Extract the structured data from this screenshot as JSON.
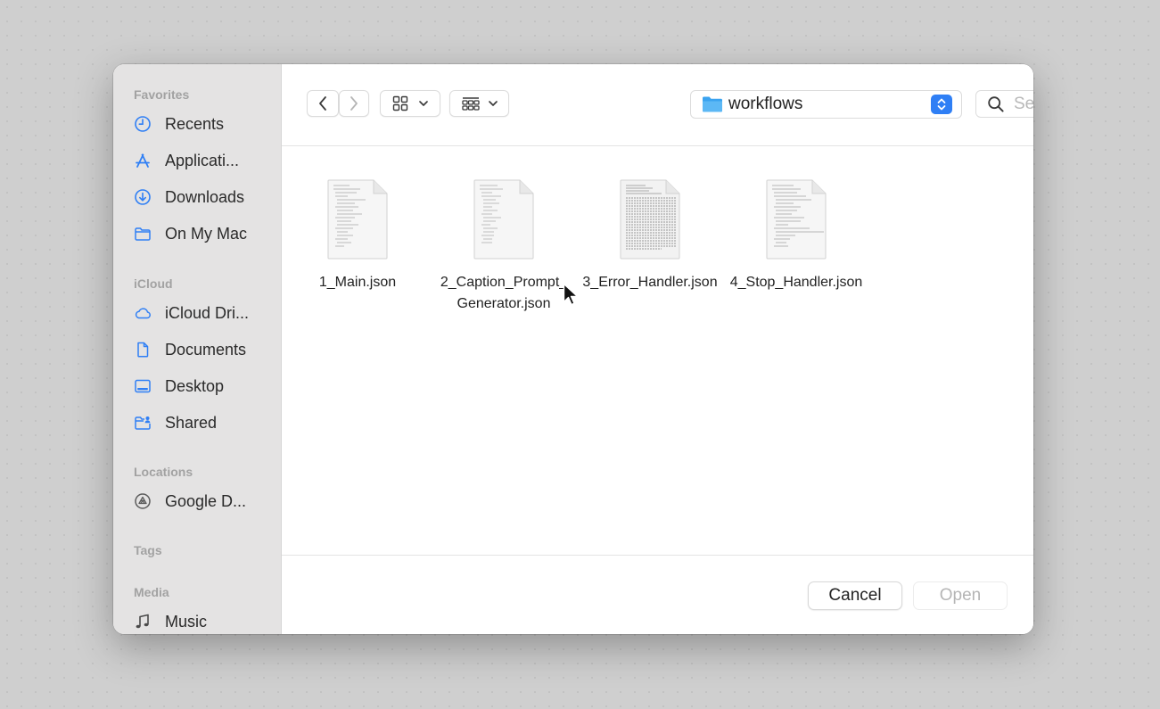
{
  "sidebar": {
    "sections": [
      {
        "heading": "Favorites",
        "items": [
          {
            "label": "Recents",
            "icon": "clock-icon"
          },
          {
            "label": "Applicati...",
            "icon": "applications-icon"
          },
          {
            "label": "Downloads",
            "icon": "download-icon"
          },
          {
            "label": "On My Mac",
            "icon": "folder-icon"
          }
        ]
      },
      {
        "heading": "iCloud",
        "items": [
          {
            "label": "iCloud Dri...",
            "icon": "cloud-icon"
          },
          {
            "label": "Documents",
            "icon": "document-icon"
          },
          {
            "label": "Desktop",
            "icon": "desktop-icon"
          },
          {
            "label": "Shared",
            "icon": "shared-folder-icon"
          }
        ]
      },
      {
        "heading": "Locations",
        "items": [
          {
            "label": "Google D...",
            "icon": "google-drive-icon"
          }
        ]
      },
      {
        "heading": "Tags",
        "items": []
      },
      {
        "heading": "Media",
        "items": [
          {
            "label": "Music",
            "icon": "music-note-icon"
          }
        ]
      }
    ]
  },
  "toolbar": {
    "current_folder": "workflows",
    "search_placeholder": "Search"
  },
  "files": [
    {
      "name": "1_Main.json",
      "thumbnail": "text"
    },
    {
      "name": "2_Caption_Prompt_Generator.json",
      "thumbnail": "text"
    },
    {
      "name": "3_Error_Handler.json",
      "thumbnail": "dense"
    },
    {
      "name": "4_Stop_Handler.json",
      "thumbnail": "text"
    }
  ],
  "footer": {
    "cancel_label": "Cancel",
    "open_label": "Open"
  },
  "colors": {
    "accent": "#2f7ff5",
    "sidebar_bg": "#e4e3e3",
    "desktop_bg": "#cfcfcf"
  }
}
